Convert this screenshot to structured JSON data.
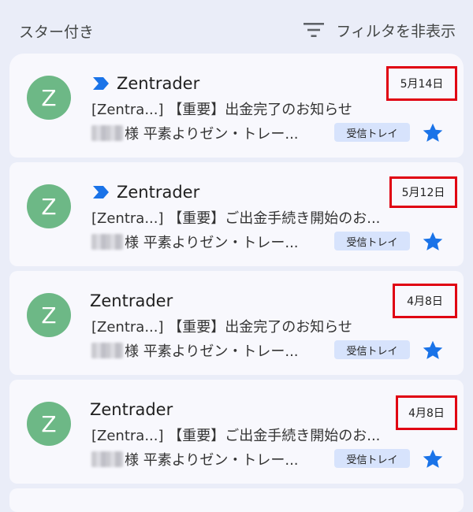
{
  "header": {
    "title": "スター付き",
    "filter_icon": "filter-list-icon",
    "filter_label": "フィルタを非表示"
  },
  "emails": [
    {
      "avatar_letter": "Z",
      "important": true,
      "sender": "Zentrader",
      "date": "5月14日",
      "subject": "[Zentra...] 【重要】出金完了のお知らせ",
      "snippet": "様 平素よりゼン・トレー...",
      "label": "受信トレイ",
      "starred": true
    },
    {
      "avatar_letter": "Z",
      "important": true,
      "sender": "Zentrader",
      "date": "5月12日",
      "subject": "[Zentra...] 【重要】ご出金手続き開始のお...",
      "snippet": "様 平素よりゼン・トレー...",
      "label": "受信トレイ",
      "starred": true
    },
    {
      "avatar_letter": "Z",
      "important": false,
      "sender": "Zentrader",
      "date": "4月8日",
      "subject": "[Zentra...] 【重要】出金完了のお知らせ",
      "snippet": "様 平素よりゼン・トレー...",
      "label": "受信トレイ",
      "starred": true
    },
    {
      "avatar_letter": "Z",
      "important": false,
      "sender": "Zentrader",
      "date": "4月8日",
      "subject": "[Zentra...] 【重要】ご出金手続き開始のお...",
      "snippet": "様 平素よりゼン・トレー...",
      "label": "受信トレイ",
      "starred": true
    }
  ],
  "colors": {
    "avatar": "#6db886",
    "star": "#1a73e8",
    "importance": "#1a73e8",
    "highlight_box": "#e00012",
    "label_chip": "#d7e3fc"
  }
}
